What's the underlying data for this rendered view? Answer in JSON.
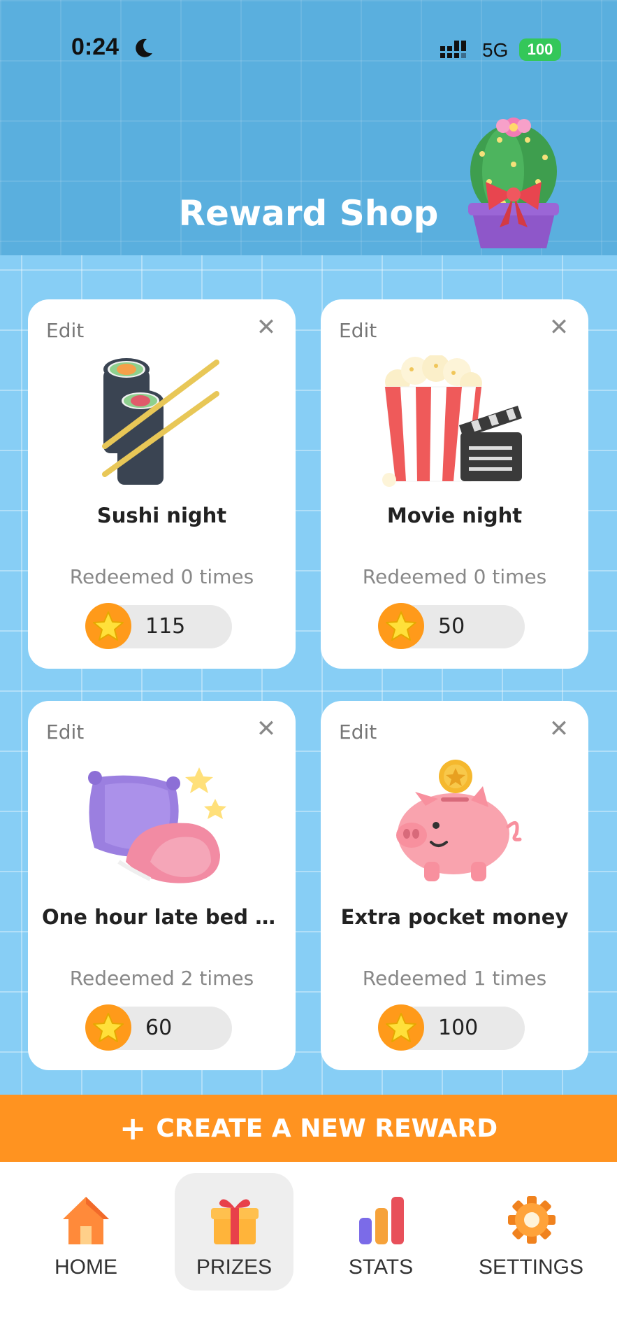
{
  "status_bar": {
    "time": "0:24",
    "network": "5G",
    "battery": "100"
  },
  "header": {
    "title": "Reward Shop"
  },
  "rewards": [
    {
      "edit_label": "Edit",
      "name": "Sushi night",
      "redeemed": "Redeemed 0 times",
      "cost": "115",
      "icon": "sushi-icon"
    },
    {
      "edit_label": "Edit",
      "name": "Movie night",
      "redeemed": "Redeemed 0 times",
      "cost": "50",
      "icon": "popcorn-icon"
    },
    {
      "edit_label": "Edit",
      "name": "One hour late bed ti...",
      "redeemed": "Redeemed 2 times",
      "cost": "60",
      "icon": "pillow-icon"
    },
    {
      "edit_label": "Edit",
      "name": "Extra pocket money",
      "redeemed": "Redeemed 1 times",
      "cost": "100",
      "icon": "piggy-bank-icon"
    }
  ],
  "create_button": {
    "label": "CREATE A NEW REWARD"
  },
  "nav": {
    "items": [
      {
        "label": "HOME",
        "icon": "home-icon",
        "active": false
      },
      {
        "label": "PRIZES",
        "icon": "gift-icon",
        "active": true
      },
      {
        "label": "STATS",
        "icon": "bar-chart-icon",
        "active": false
      },
      {
        "label": "SETTINGS",
        "icon": "gear-icon",
        "active": false
      }
    ]
  },
  "colors": {
    "header_bg": "#5AAFDE",
    "content_bg": "#87CEF5",
    "accent": "#FF9320",
    "coin": "#FF9A1A",
    "star": "#FFE03A"
  }
}
